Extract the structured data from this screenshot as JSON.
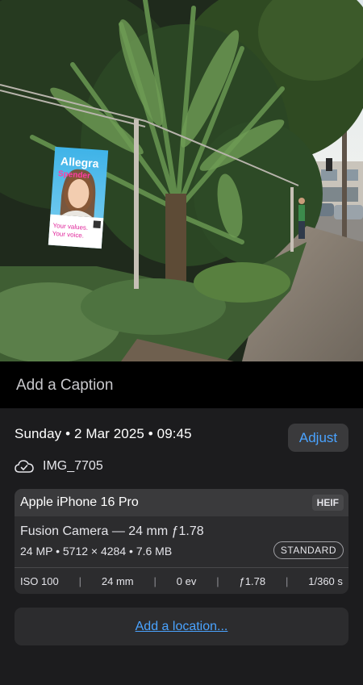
{
  "photo": {
    "sign": {
      "name": "Allegra",
      "surname": "Spender",
      "slogan_line1": "Your values.",
      "slogan_line2": "Your voice."
    }
  },
  "caption": {
    "placeholder": "Add a Caption"
  },
  "info": {
    "date_line": "Sunday • 2 Mar 2025 • 09:45",
    "adjust_label": "Adjust",
    "filename": "IMG_7705",
    "cloud_icon": "icloud-check-icon"
  },
  "camera": {
    "device": "Apple iPhone 16 Pro",
    "format": "HEIF",
    "lens": "Fusion Camera — 24 mm ƒ1.78",
    "specs": "24 MP • 5712 × 4284 • 7.6 MB",
    "style": "STANDARD",
    "exif": {
      "iso": "ISO 100",
      "focal": "24 mm",
      "ev": "0 ev",
      "aperture": "ƒ1.78",
      "shutter": "1/360 s"
    }
  },
  "location": {
    "label": "Add a location..."
  },
  "colors": {
    "accent": "#4aa3ff",
    "background": "#1c1c1e",
    "card": "#2c2c2e"
  }
}
